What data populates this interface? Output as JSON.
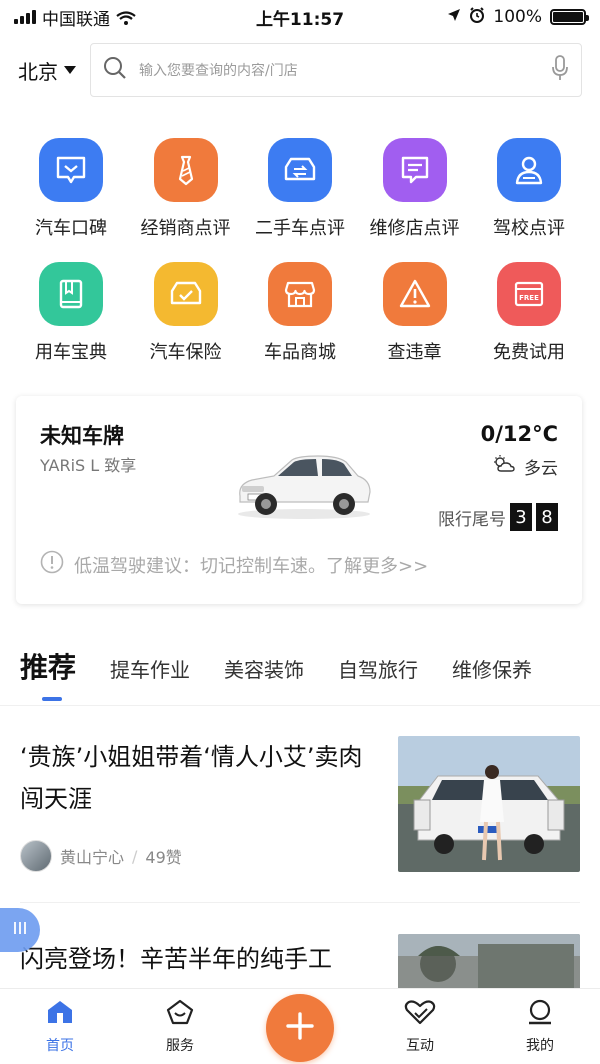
{
  "status_bar": {
    "carrier": "中国联通",
    "time": "上午11:57",
    "battery": "100%",
    "battery_level": 1.0
  },
  "header": {
    "city": "北京",
    "search_placeholder": "输入您要查询的内容/门店"
  },
  "grid": {
    "row1": [
      {
        "label": "汽车口碑",
        "icon": "chat-heart-icon",
        "color": "#3d7cf2"
      },
      {
        "label": "经销商点评",
        "icon": "tie-icon",
        "color": "#f07a3c"
      },
      {
        "label": "二手车点评",
        "icon": "car-exchange-icon",
        "color": "#3d7cf2"
      },
      {
        "label": "维修店点评",
        "icon": "message-icon",
        "color": "#a15ef0"
      },
      {
        "label": "驾校点评",
        "icon": "driver-icon",
        "color": "#3d7cf2"
      }
    ],
    "row2": [
      {
        "label": "用车宝典",
        "icon": "book-icon",
        "color": "#33c79a"
      },
      {
        "label": "汽车保险",
        "icon": "car-shield-icon",
        "color": "#f4b930"
      },
      {
        "label": "车品商城",
        "icon": "shop-icon",
        "color": "#f07a3c"
      },
      {
        "label": "查违章",
        "icon": "warning-icon",
        "color": "#f07a3c"
      },
      {
        "label": "免费试用",
        "icon": "free-gift-icon",
        "color": "#ef5a5a"
      }
    ]
  },
  "car_card": {
    "plate": "未知车牌",
    "model": "YARiS L 致享",
    "temperature": "0/12°C",
    "weather": "多云",
    "limit_label": "限行尾号",
    "limit_numbers": [
      "3",
      "8"
    ],
    "tip": "低温驾驶建议：切记控制车速。了解更多>>"
  },
  "tabs": {
    "items": [
      "推荐",
      "提车作业",
      "美容装饰",
      "自驾旅行",
      "维修保养"
    ]
  },
  "articles": [
    {
      "title": "‘贵族’小姐姐带着‘情人小艾’卖肉闯天涯",
      "author": "黄山宁心",
      "likes": "49赞"
    },
    {
      "title": "闪亮登场！辛苦半年的纯手工"
    }
  ],
  "bottom_nav": {
    "items": [
      "首页",
      "服务",
      "互动",
      "我的"
    ]
  },
  "colors": {
    "accent": "#3c73e6",
    "orange": "#f07a3c"
  }
}
